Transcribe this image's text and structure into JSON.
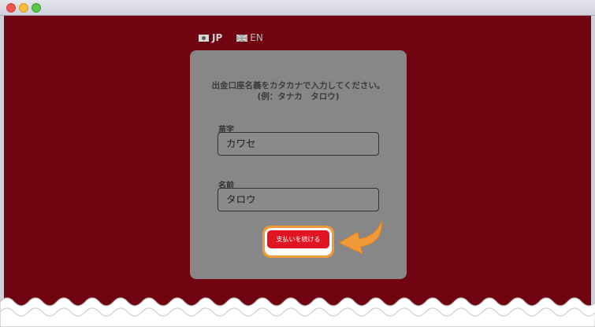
{
  "window": {
    "controls": [
      "close",
      "minimize",
      "maximize"
    ]
  },
  "language": {
    "jp_label": "JP",
    "en_label": "EN",
    "jp_icon": "camera-flag-icon",
    "en_icon": "uk-flag-icon"
  },
  "form": {
    "instruction_line1": "出金口座名義をカタカナで入力してください。",
    "instruction_line2": "(例：タナカ　タロウ)",
    "surname_label": "苗字",
    "surname_value": "カワセ",
    "given_name_label": "名前",
    "given_name_value": "タロウ",
    "continue_button": "支払いを続ける"
  },
  "colors": {
    "background": "#700511",
    "card": "#878787",
    "button": "#e11521",
    "highlight": "#f19a38"
  }
}
